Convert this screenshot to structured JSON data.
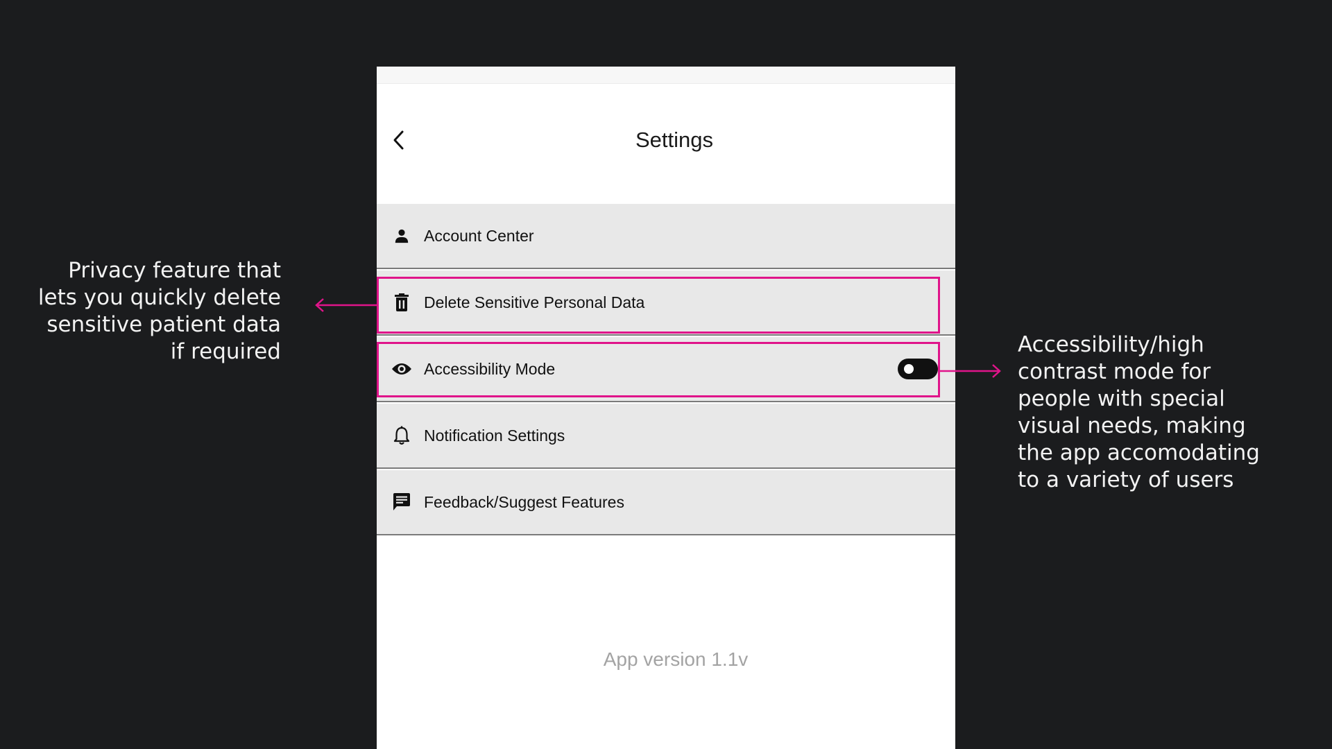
{
  "header": {
    "title": "Settings",
    "back_icon": "chevron-left-icon"
  },
  "menu": {
    "items": [
      {
        "label": "Account Center",
        "icon": "person-icon"
      },
      {
        "label": "Delete Sensitive Personal Data",
        "icon": "trash-icon"
      },
      {
        "label": "Accessibility Mode",
        "icon": "eye-icon",
        "toggle": "off"
      },
      {
        "label": "Notification Settings",
        "icon": "bell-icon"
      },
      {
        "label": "Feedback/Suggest Features",
        "icon": "chat-icon"
      }
    ]
  },
  "footer": {
    "version": "App version 1.1v"
  },
  "annotations": {
    "left": {
      "lines": [
        "Privacy feature that",
        "lets you quickly delete",
        "sensitive patient data",
        "if required"
      ]
    },
    "right": {
      "lines": [
        "Accessibility/high",
        "contrast mode for",
        "people with special",
        "visual needs, making",
        "the app accomodating",
        "to a variety of users"
      ]
    }
  },
  "colors": {
    "background": "#1b1c1e",
    "accent_highlight": "#e0148a",
    "row_background": "#e8e8e8",
    "version_text": "#a3a3a3"
  }
}
